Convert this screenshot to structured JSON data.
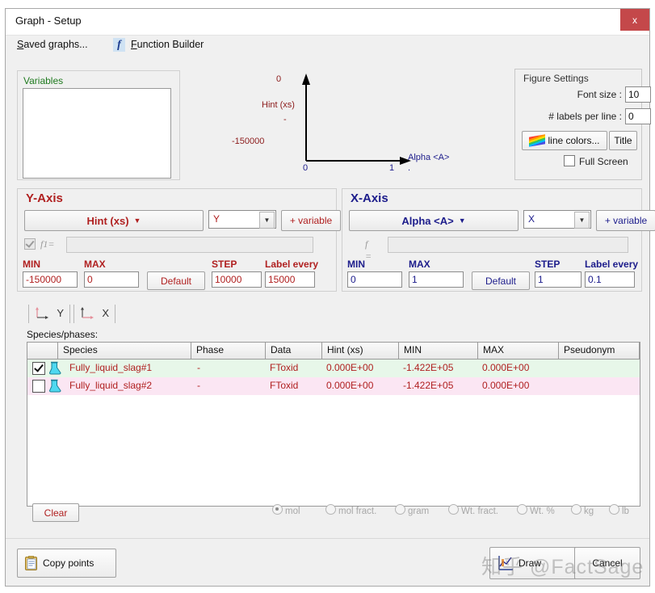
{
  "window": {
    "title": "Graph - Setup",
    "close_label": "x"
  },
  "menubar": {
    "saved_graphs": "Saved graphs...",
    "function_builder": "Function Builder",
    "function_builder_icon": "f"
  },
  "variables": {
    "legend": "Variables",
    "items": []
  },
  "preview": {
    "y_top_tick": "0",
    "y_axis_label": "Hint (xs)",
    "y_mid_tick": "-",
    "y_bottom_tick": "-150000",
    "x_left_tick": "0",
    "x_right_tick": "1",
    "x_axis_label": "Alpha <A>",
    "x_sub_tick": "."
  },
  "figure_settings": {
    "legend": "Figure Settings",
    "font_size_label": "Font size :",
    "font_size_value": "10",
    "labels_per_line_label": "# labels per line :",
    "labels_per_line_value": "0",
    "line_colors_label": "line colors...",
    "title_label": "Title",
    "full_screen_label": "Full Screen",
    "full_screen_checked": false
  },
  "y_axis": {
    "title": "Y-Axis",
    "variable_button": "Hint (xs)",
    "combo_value": "Y",
    "add_variable_label": "+ variable",
    "fn_checkbox_checked": true,
    "fn_label": "f1=",
    "fn_value": "",
    "min_label": "MIN",
    "min_value": "-150000",
    "max_label": "MAX",
    "max_value": "0",
    "default_label": "Default",
    "step_label": "STEP",
    "step_value": "10000",
    "label_every_label": "Label every",
    "label_every_value": "15000"
  },
  "x_axis": {
    "title": "X-Axis",
    "variable_button": "Alpha <A>",
    "combo_value": "X",
    "add_variable_label": "+ variable",
    "fn_label": "f =",
    "fn_value": "",
    "min_label": "MIN",
    "min_value": "0",
    "max_label": "MAX",
    "max_value": "1",
    "default_label": "Default",
    "step_label": "STEP",
    "step_value": "1",
    "label_every_label": "Label every",
    "label_every_value": "0.1"
  },
  "tabs": {
    "active": "Y",
    "items": [
      {
        "label": "Y"
      },
      {
        "label": "X"
      }
    ]
  },
  "table": {
    "caption": "Species/phases:",
    "columns": [
      "",
      "Species",
      "Phase",
      "Data",
      "Hint (xs)",
      "MIN",
      "MAX",
      "Pseudonym",
      ""
    ],
    "rows": [
      {
        "checked": true,
        "species": "Fully_liquid_slag#1",
        "phase": "-",
        "data": "FToxid",
        "hint_xs": "0.000E+00",
        "min": "-1.422E+05",
        "max": "0.000E+00",
        "pseudonym": "",
        "row_color": "#e7f7e9"
      },
      {
        "checked": false,
        "species": "Fully_liquid_slag#2",
        "phase": "-",
        "data": "FToxid",
        "hint_xs": "0.000E+00",
        "min": "-1.422E+05",
        "max": "0.000E+00",
        "pseudonym": "",
        "row_color": "#fbe6f3"
      }
    ]
  },
  "units": {
    "clear_label": "Clear",
    "selected": "mol",
    "options": [
      "mol",
      "mol fract.",
      "gram",
      "Wt. fract.",
      "Wt. %",
      "kg",
      "lb"
    ]
  },
  "footer": {
    "copy_points_label": "Copy points",
    "draw_label": "Draw",
    "cancel_label": "Cancel"
  },
  "watermark": {
    "text": "知乎 @FactSage"
  },
  "colors": {
    "accent_red": "#b02020",
    "accent_blue": "#1c1c8b",
    "close_red": "#c4484a",
    "variables_green": "#1f7a1f",
    "row1": "#e7f7e9",
    "row2": "#fbe6f3"
  }
}
